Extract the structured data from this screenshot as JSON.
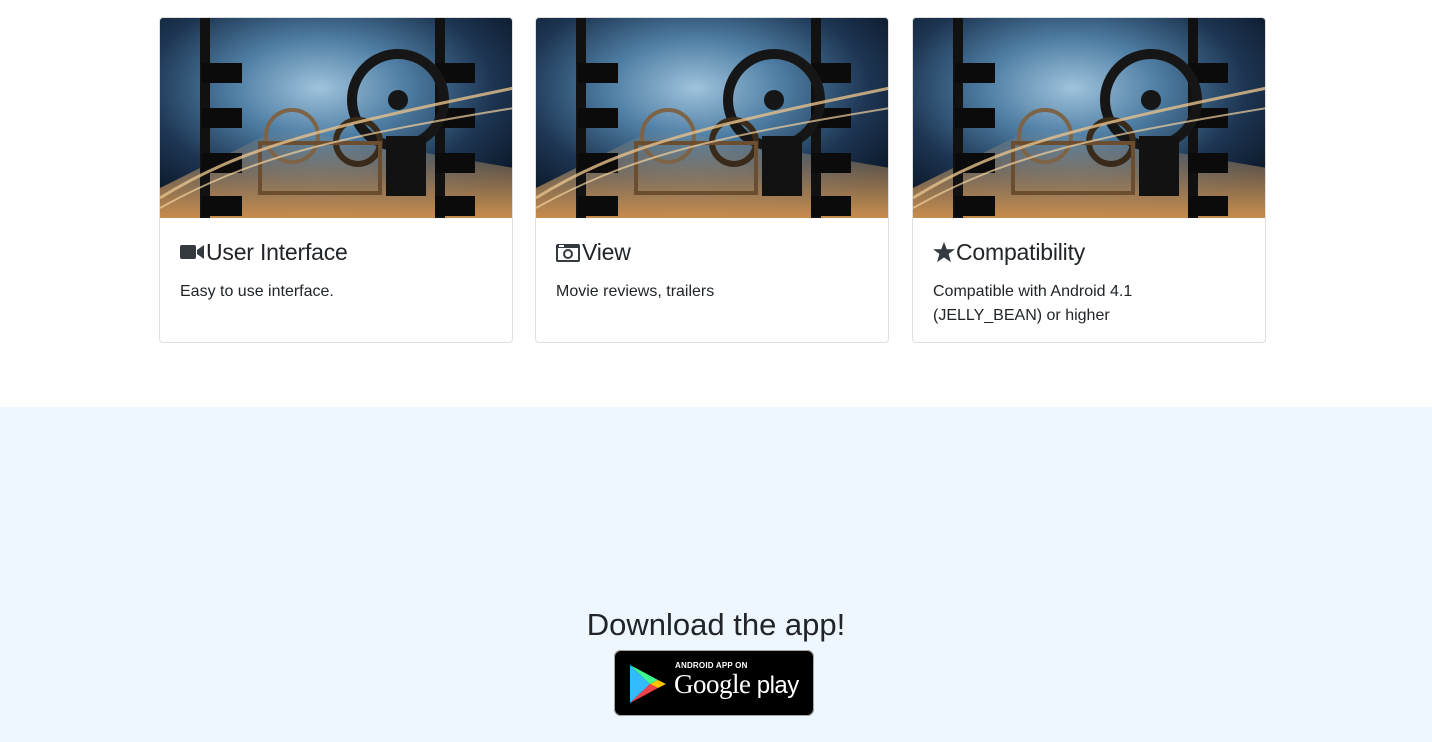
{
  "features": {
    "cards": [
      {
        "icon": "video-camera-icon",
        "title": "User Interface",
        "text": "Easy to use interface."
      },
      {
        "icon": "camera-icon",
        "title": "View",
        "text": "Movie reviews, trailers"
      },
      {
        "icon": "star-icon",
        "title": "Compatibility",
        "text": "Compatible with Android 4.1 (JELLY_BEAN) or higher"
      }
    ],
    "image_subject": "film-projector-image"
  },
  "download": {
    "title": "Download the app!",
    "badge": {
      "small_text": "ANDROID APP ON",
      "brand_text": "Google",
      "product_text": "play"
    }
  },
  "colors": {
    "download_background": "#eef7fe",
    "text": "#212529",
    "card_border": "rgba(0,0,0,0.125)"
  }
}
